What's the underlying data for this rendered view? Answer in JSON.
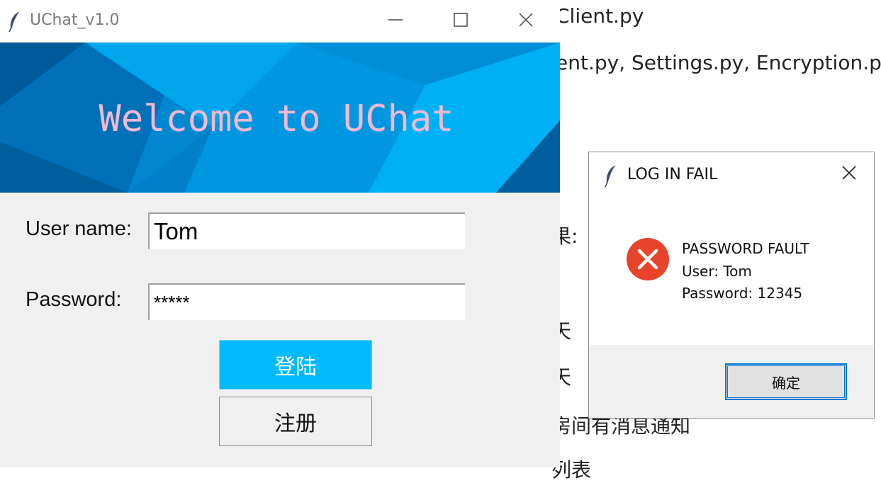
{
  "background_doc": {
    "lines": [
      "Client.py",
      "ent.py, Settings.py, Encryption.p",
      "果:",
      "天",
      "天",
      "房间有消息通知",
      "列表"
    ]
  },
  "main_window": {
    "title": "UChat_v1.0",
    "banner_text": "Welcome to UChat",
    "username_label": "User name:",
    "username_value": "Tom",
    "password_label": "Password:",
    "password_value": "*****",
    "login_button": "登陆",
    "register_button": "注册"
  },
  "dialog": {
    "title": "LOG IN FAIL",
    "messages": [
      "PASSWORD FAULT",
      "User: Tom",
      "Password: 12345"
    ],
    "ok_button": "确定"
  },
  "icons": {
    "app": "feather-icon",
    "minimize": "minimize-icon",
    "maximize": "maximize-icon",
    "close": "close-icon",
    "error": "error-icon"
  },
  "colors": {
    "banner": "#0087d0",
    "banner_text": "#f3b9d2",
    "login_button": "#00b9ff",
    "error": "#e8432b",
    "focus_border": "#0078d7"
  }
}
